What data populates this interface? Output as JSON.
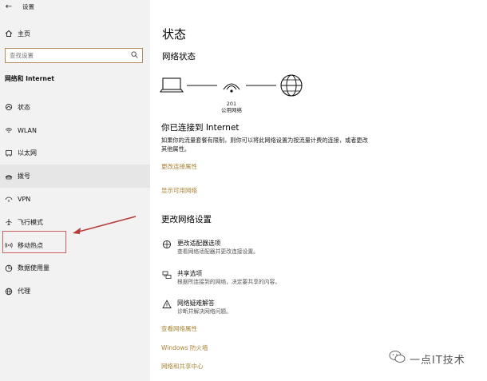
{
  "window": {
    "title": "设置",
    "back_glyph": "←",
    "controls": {
      "minimize": "—",
      "maximize": "☐",
      "close": "✕"
    }
  },
  "sidebar": {
    "home_label": "主页",
    "search_placeholder": "查找设置",
    "section_title": "网络和 Internet",
    "items": [
      {
        "label": "状态",
        "icon": "status-icon"
      },
      {
        "label": "WLAN",
        "icon": "wifi-icon"
      },
      {
        "label": "以太网",
        "icon": "ethernet-icon"
      },
      {
        "label": "拨号",
        "icon": "dialup-icon",
        "selected": true
      },
      {
        "label": "VPN",
        "icon": "vpn-icon"
      },
      {
        "label": "飞行模式",
        "icon": "airplane-icon"
      },
      {
        "label": "移动热点",
        "icon": "hotspot-icon"
      },
      {
        "label": "数据使用量",
        "icon": "data-usage-icon"
      },
      {
        "label": "代理",
        "icon": "proxy-icon"
      }
    ]
  },
  "main": {
    "page_title": "状态",
    "network_status_title": "网络状态",
    "network_number": "201",
    "network_type": "公用网络",
    "connected_title": "你已连接到 Internet",
    "connected_desc": "如果你的流量套餐有限制，则你可以将此网络设置为按流量计费的连接，或者更改其他属性。",
    "change_conn_props": "更改连接属性",
    "show_available": "显示可用网络",
    "change_settings_title": "更改网络设置",
    "options": [
      {
        "title": "更改适配器选项",
        "subtitle": "查看网络适配器并更改连接设置。",
        "icon": "adapter-icon"
      },
      {
        "title": "共享选项",
        "subtitle": "根据所连接到的网络，决定要共享的内容。",
        "icon": "sharing-icon"
      },
      {
        "title": "网络疑难解答",
        "subtitle": "诊断并解决网络问题。",
        "icon": "warning-icon"
      }
    ],
    "links": {
      "view_props": "查看网络属性",
      "firewall": "Windows 防火墙",
      "sharing_center": "网络和共享中心"
    }
  },
  "watermark": {
    "text": "一点IT技术"
  },
  "colors": {
    "link": "#a88334",
    "highlight_box": "#c86060",
    "arrow": "#b83a3a",
    "sidebar_bg": "#f2f2f2"
  }
}
